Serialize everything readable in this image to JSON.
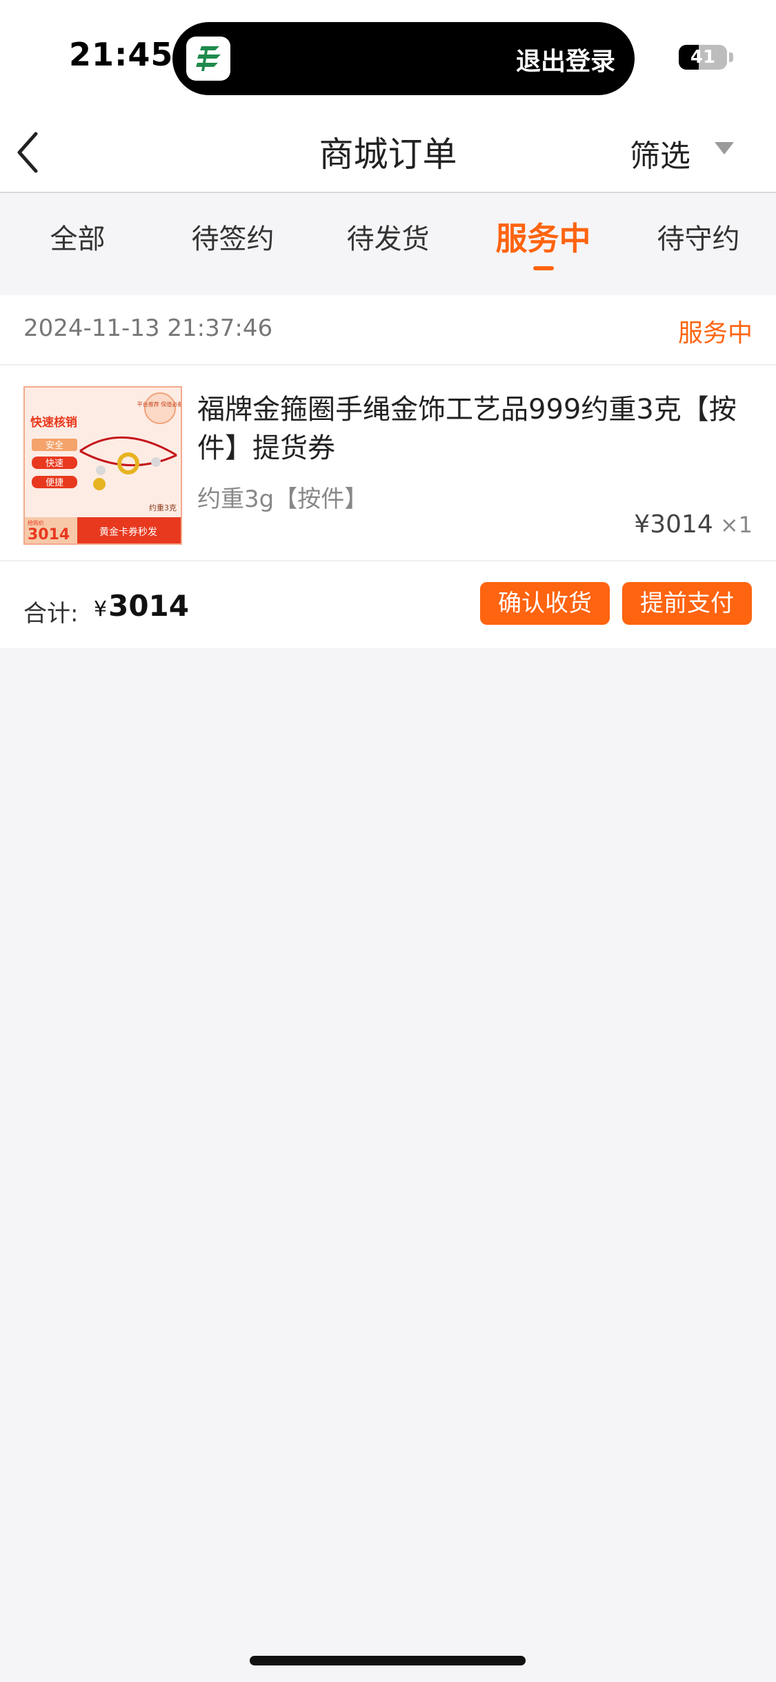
{
  "status_bar": {
    "time": "21:45",
    "island_action": "退出登录",
    "battery_level": 41,
    "battery_text": "41",
    "app_icon": "china-post-icon"
  },
  "nav": {
    "title": "商城订单",
    "filter_label": "筛选",
    "back_icon": "chevron-left-icon",
    "filter_icon": "caret-down-icon"
  },
  "tabs": [
    {
      "label": "全部",
      "active": false
    },
    {
      "label": "待签约",
      "active": false
    },
    {
      "label": "待发货",
      "active": false
    },
    {
      "label": "服务中",
      "active": true
    },
    {
      "label": "待守约",
      "active": false
    }
  ],
  "order": {
    "date": "2024-11-13 21:37:46",
    "status": "服务中",
    "product": {
      "title": "福牌金箍圈手绳金饰工艺品999约重3克【按件】提货券",
      "spec": "约重3g【按件】",
      "price": "¥3014",
      "quantity": "×1",
      "image_text": {
        "headline": "快速核销",
        "tag1": "安全",
        "tag2": "快速",
        "tag3": "便捷",
        "badge": "平台推荐 保值必备",
        "weight": "约重3克",
        "price_label": "抢购价",
        "price": "3014",
        "banner": "黄金卡券秒发"
      }
    },
    "total_label": "合计:",
    "total_currency": "¥",
    "total_value": "3014",
    "actions": {
      "confirm": "确认收货",
      "prepay": "提前支付"
    }
  },
  "colors": {
    "accent": "#ff6410",
    "background": "#f5f5f7"
  }
}
